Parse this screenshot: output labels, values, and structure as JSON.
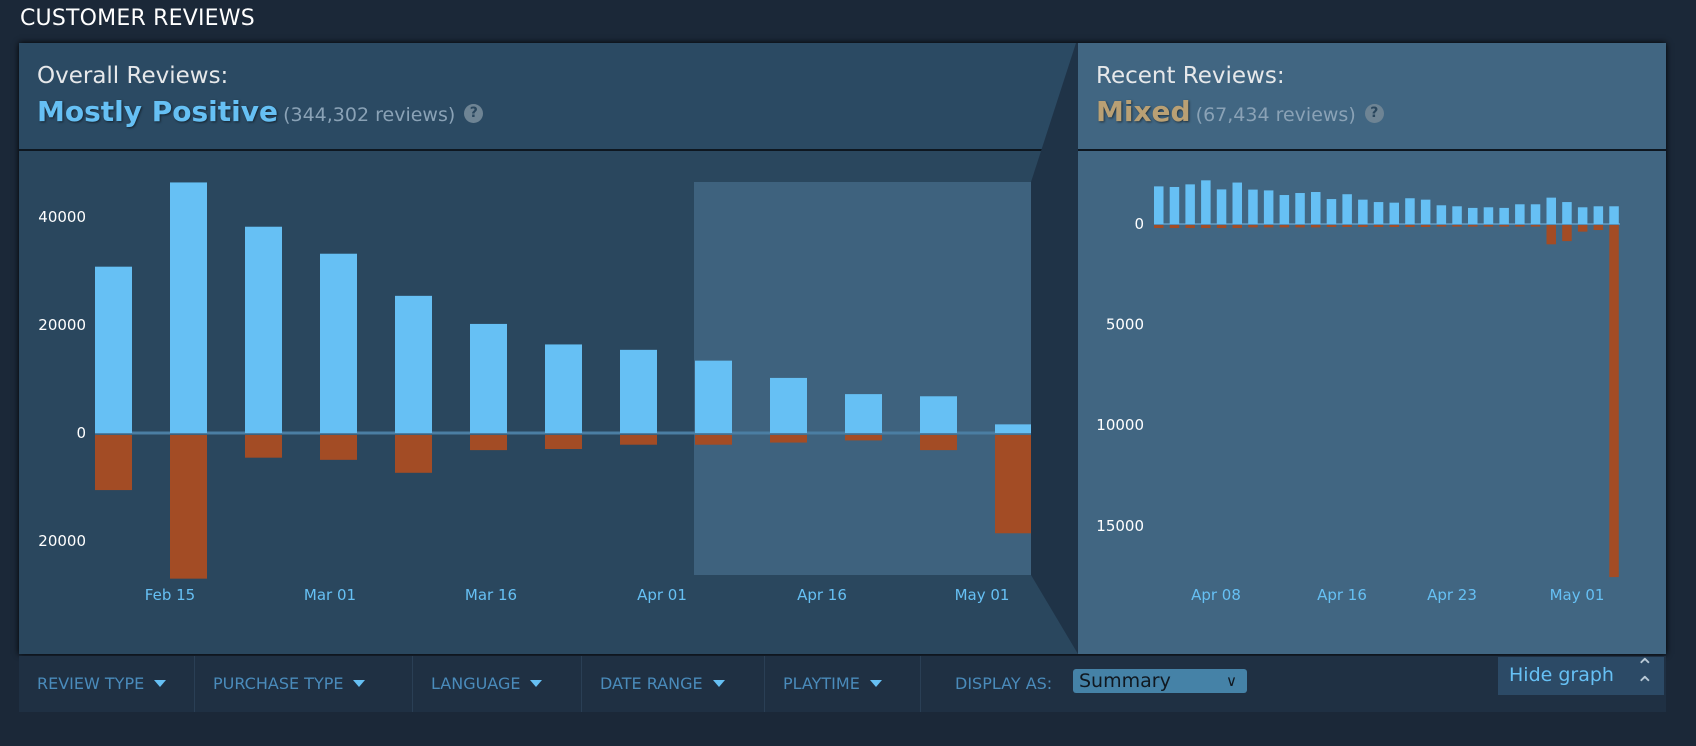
{
  "section_title": "CUSTOMER REVIEWS",
  "overall": {
    "label": "Overall Reviews:",
    "summary": "Mostly Positive",
    "count": "(344,302 reviews)",
    "help": "?",
    "summary_color": "#66c0f4"
  },
  "recent": {
    "label": "Recent Reviews:",
    "summary": "Mixed",
    "count": "(67,434 reviews)",
    "help": "?",
    "summary_color": "#b9a074"
  },
  "filters": [
    {
      "label": "REVIEW TYPE"
    },
    {
      "label": "PURCHASE TYPE"
    },
    {
      "label": "LANGUAGE"
    },
    {
      "label": "DATE RANGE"
    },
    {
      "label": "PLAYTIME"
    }
  ],
  "display_as": {
    "label": "DISPLAY AS:",
    "value": "Summary"
  },
  "hide_graph": "Hide graph",
  "colors": {
    "positive": "#66c0f4",
    "negative": "#a34c25",
    "background": "#1b2838"
  },
  "chart_data": [
    {
      "type": "bar",
      "name": "overall",
      "yticks": [
        {
          "v": 40000,
          "label": "40000"
        },
        {
          "v": 20000,
          "label": "20000"
        },
        {
          "v": 0,
          "label": "0"
        },
        {
          "v": -20000,
          "label": "20000"
        }
      ],
      "xticks": [
        "Feb 15",
        "Mar 01",
        "Mar 16",
        "Apr 01",
        "Apr 16",
        "May 01"
      ],
      "ylim": [
        -27000,
        47000
      ],
      "positive": [
        30800,
        46400,
        38200,
        33200,
        25400,
        20200,
        16400,
        15400,
        13400,
        10200,
        7200,
        6800,
        1600
      ],
      "negative": [
        -10200,
        -26600,
        -4200,
        -4600,
        -7000,
        -2800,
        -2600,
        -1800,
        -1800,
        -1400,
        -1000,
        -2800,
        -18200
      ],
      "highlighted_range": "recent period (last 5 bars)"
    },
    {
      "type": "bar",
      "name": "recent",
      "yticks": [
        {
          "v": 0,
          "label": "0"
        },
        {
          "v": -5000,
          "label": "5000"
        },
        {
          "v": -10000,
          "label": "10000"
        },
        {
          "v": -15000,
          "label": "15000"
        }
      ],
      "xticks": [
        "Apr 08",
        "Apr 16",
        "Apr 23",
        "May 01"
      ],
      "positive": [
        1870,
        1840,
        1970,
        2170,
        1720,
        2060,
        1710,
        1670,
        1440,
        1540,
        1590,
        1240,
        1480,
        1210,
        1090,
        1060,
        1280,
        1210,
        930,
        880,
        800,
        830,
        800,
        980,
        980,
        1310,
        1090,
        830,
        880,
        880
      ],
      "negative": [
        -150,
        -150,
        -150,
        -150,
        -150,
        -150,
        -120,
        -120,
        -120,
        -120,
        -120,
        -100,
        -100,
        -100,
        -100,
        -100,
        -100,
        -100,
        -80,
        -80,
        -80,
        -80,
        -80,
        -80,
        -80,
        -960,
        -800,
        -330,
        -250,
        -17500
      ]
    }
  ]
}
